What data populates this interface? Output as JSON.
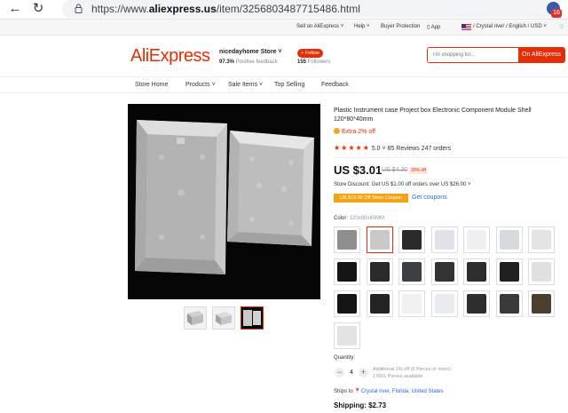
{
  "browser": {
    "url_prefix": "https://www.",
    "url_host": "aliexpress.us",
    "url_path": "/item/3256803487715486.html",
    "extension_count": "16"
  },
  "top_strip": {
    "sell": "Sell on AliExpress ˅",
    "help": "Help ˅",
    "buyer_protection": "Buyer Protection",
    "app": "App",
    "locale": "/ Crystal river / English / USD ˅"
  },
  "header": {
    "logo": "AliExpress",
    "store_name": "nicedayhome Store ˅",
    "feedback_pct": "97.3%",
    "feedback_label": "Positive feedback",
    "follow_label": "+ Follow",
    "followers_count": "155",
    "followers_label": "Followers",
    "search_placeholder": "I'm shopping for...",
    "search_button": "On AliExpress"
  },
  "store_nav": [
    "Store Home",
    "Products ˅",
    "Sale Items ˅",
    "Top Selling",
    "Feedback"
  ],
  "product": {
    "title": "Plastic Instrument case Project box Electronic Component Module Shell 120*80*40mm",
    "extra_off": "Extra 2% off",
    "stars": "★★★★★",
    "rating": "5.0 ˅",
    "reviews": "85 Reviews",
    "orders": "247 orders",
    "price": "US $3.01",
    "old_price": "US $4.30",
    "discount": "30% off",
    "store_discount": "Store Discount: Get US $1.00 off orders over US $26.00 ˅",
    "coupon_badge": "US $10.00 Off Store Coupon",
    "get_coupons": "Get coupons",
    "color_label": "Color:",
    "color_value": "120x80x40MM",
    "quantity_label": "Quantity:",
    "quantity": "4",
    "qty_minus": "−",
    "qty_plus": "+",
    "qty_note_1": "Additional 1% off (6 Pieces or more)",
    "qty_note_2": "17601 Pieces available",
    "ships_to_label": "Ships to",
    "ships_to_location": "Crystal river, Florida, United States",
    "shipping": "Shipping: $2.73"
  },
  "swatches": [
    {
      "color": "#8f8f8f"
    },
    {
      "color": "#c9c9c9"
    },
    {
      "color": "#2b2b2b"
    },
    {
      "color": "#dfe3e8"
    },
    {
      "color": "#eef0f2"
    },
    {
      "color": "#d8dbde"
    },
    {
      "color": "#e4e4e4"
    },
    {
      "color": "#151515"
    },
    {
      "color": "#2a2a2a"
    },
    {
      "color": "#3c3f44"
    },
    {
      "color": "#333"
    },
    {
      "color": "#2d2d2d"
    },
    {
      "color": "#1f1f1f"
    },
    {
      "color": "#e0e0e0"
    },
    {
      "color": "#141414"
    },
    {
      "color": "#242424"
    },
    {
      "color": "#f1f1f1"
    },
    {
      "color": "#e9ecef"
    },
    {
      "color": "#2e2e2e"
    },
    {
      "color": "#3a3a3a"
    },
    {
      "color": "#4b3f30"
    },
    {
      "color": "#e3e3e3"
    }
  ]
}
